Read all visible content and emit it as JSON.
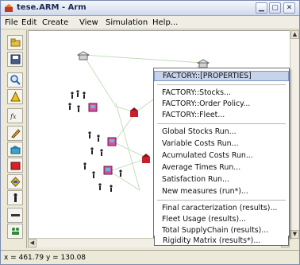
{
  "window": {
    "title": "tese.ARM - Arm"
  },
  "menu": [
    "File",
    "Edit",
    "Create",
    "View",
    "Simulation",
    "Help..."
  ],
  "toolbar": {
    "tools": [
      "open-icon",
      "save-icon",
      "zoom-in-icon",
      "warning-icon",
      "function-icon",
      "pencil-icon",
      "factory-icon",
      "stock-icon",
      "warehouse-icon",
      "person-icon",
      "link-icon",
      "group-icon"
    ]
  },
  "context_menu": {
    "items": [
      "FACTORY::[PROPERTIES]",
      "FACTORY::Stocks...",
      "FACTORY::Order Policy...",
      "FACTORY::Fleet...",
      "Global Stocks Run...",
      "Variable Costs Run...",
      "Acumulated Costs Run...",
      "Average Times Run...",
      "Satisfaction Run...",
      "New measures (run*)...",
      "Final caracterization (results)...",
      "Fleet Usage (results)...",
      "Total SupplyChain (results)...",
      "Rigidity Matrix (results*)..."
    ],
    "highlighted_index": 0
  },
  "status": {
    "text": "x = 461.79  y = 130.08"
  },
  "colors": {
    "highlight": "#c7d3ea",
    "titlebar": "#dfe5f2",
    "chrome": "#ece9d8"
  }
}
